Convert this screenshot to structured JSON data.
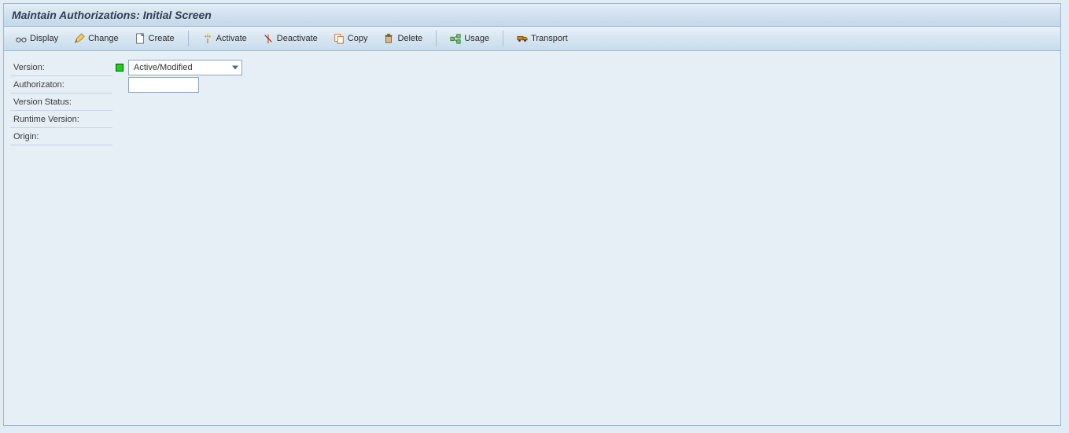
{
  "window": {
    "title": "Maintain Authorizations: Initial Screen"
  },
  "toolbar": {
    "display": "Display",
    "change": "Change",
    "create": "Create",
    "activate": "Activate",
    "deactivate": "Deactivate",
    "copy": "Copy",
    "delete": "Delete",
    "usage": "Usage",
    "transport": "Transport"
  },
  "form": {
    "version_label": "Version:",
    "version_value": "Active/Modified",
    "authorization_label": "Authorizaton:",
    "authorization_value": "",
    "version_status_label": "Version Status:",
    "runtime_version_label": "Runtime Version:",
    "origin_label": "Origin:"
  }
}
